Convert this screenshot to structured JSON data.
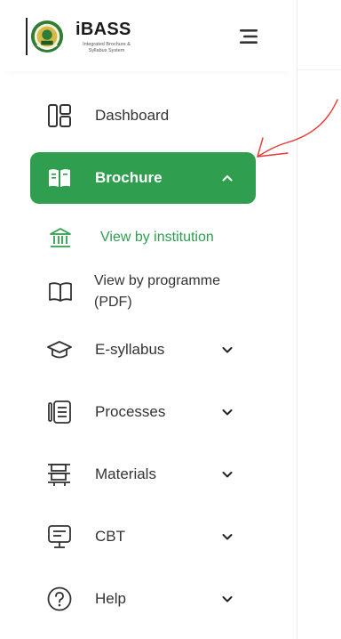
{
  "logo": {
    "title": "iBASS",
    "subtitle": "Integrated Brochure & Syllabus System"
  },
  "nav": {
    "dashboard": "Dashboard",
    "brochure": "Brochure",
    "view_by_institution": "View by institution",
    "view_by_programme": "View by programme (PDF)",
    "esyllabus": "E-syllabus",
    "processes": "Processes",
    "materials": "Materials",
    "cbt": "CBT",
    "help": "Help"
  },
  "colors": {
    "accent": "#2f9e4f",
    "annotation": "#e53935"
  },
  "icons": {
    "dashboard": "dashboard-grid-icon",
    "brochure": "open-book-icon",
    "institution": "institution-building-icon",
    "programme": "book-outline-icon",
    "esyllabus": "graduation-cap-icon",
    "processes": "notebook-icon",
    "materials": "stack-icon",
    "cbt": "monitor-icon",
    "help": "help-circle-icon",
    "chevron_down": "chevron-down-icon",
    "chevron_up": "chevron-up-icon",
    "menu": "hamburger-menu-icon"
  }
}
